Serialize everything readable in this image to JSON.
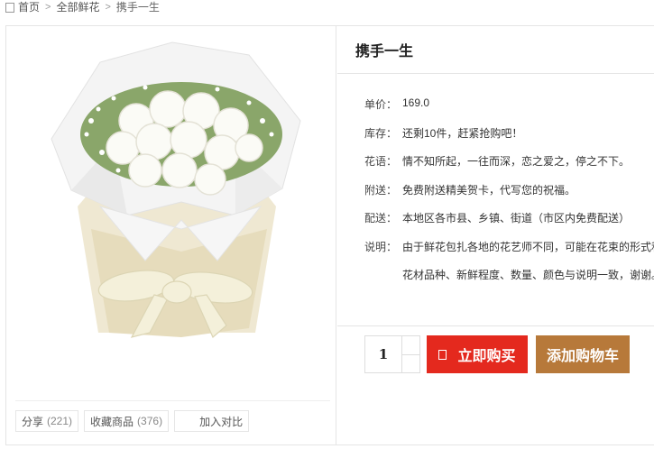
{
  "breadcrumb": {
    "home": "首页",
    "category": "全部鲜花",
    "current": "携手一生"
  },
  "product": {
    "title": "携手一生",
    "image_alt": "白玫瑰花束",
    "props": [
      {
        "key": "单价：",
        "value": "169.0"
      },
      {
        "key": "库存：",
        "value": "还剩10件，赶紧抢购吧！"
      },
      {
        "key": "花语：",
        "value": "情不知所起，一往而深，恋之爱之，停之不下。"
      },
      {
        "key": "附送：",
        "value": "免费附送精美贺卡，代写您的祝福。"
      },
      {
        "key": "配送：",
        "value": "本地区各市县、乡镇、街道（市区内免费配送）"
      }
    ],
    "note": {
      "key": "说明：",
      "line1": "由于鲜花包扎各地的花艺师不同，可能在花束的形式和",
      "line2": "花材品种、新鲜程度、数量、颜色与说明一致，谢谢。"
    }
  },
  "purchase": {
    "quantity": "1",
    "buy_now": "立即购买",
    "add_to_cart": "添加购物车"
  },
  "actions": {
    "share_label": "分享",
    "share_count": "(221)",
    "favorite_label": "收藏商品",
    "favorite_count": "(376)",
    "compare_label": "加入对比"
  },
  "colors": {
    "buy_button": "#e4291e",
    "cart_button": "#b7793a"
  }
}
